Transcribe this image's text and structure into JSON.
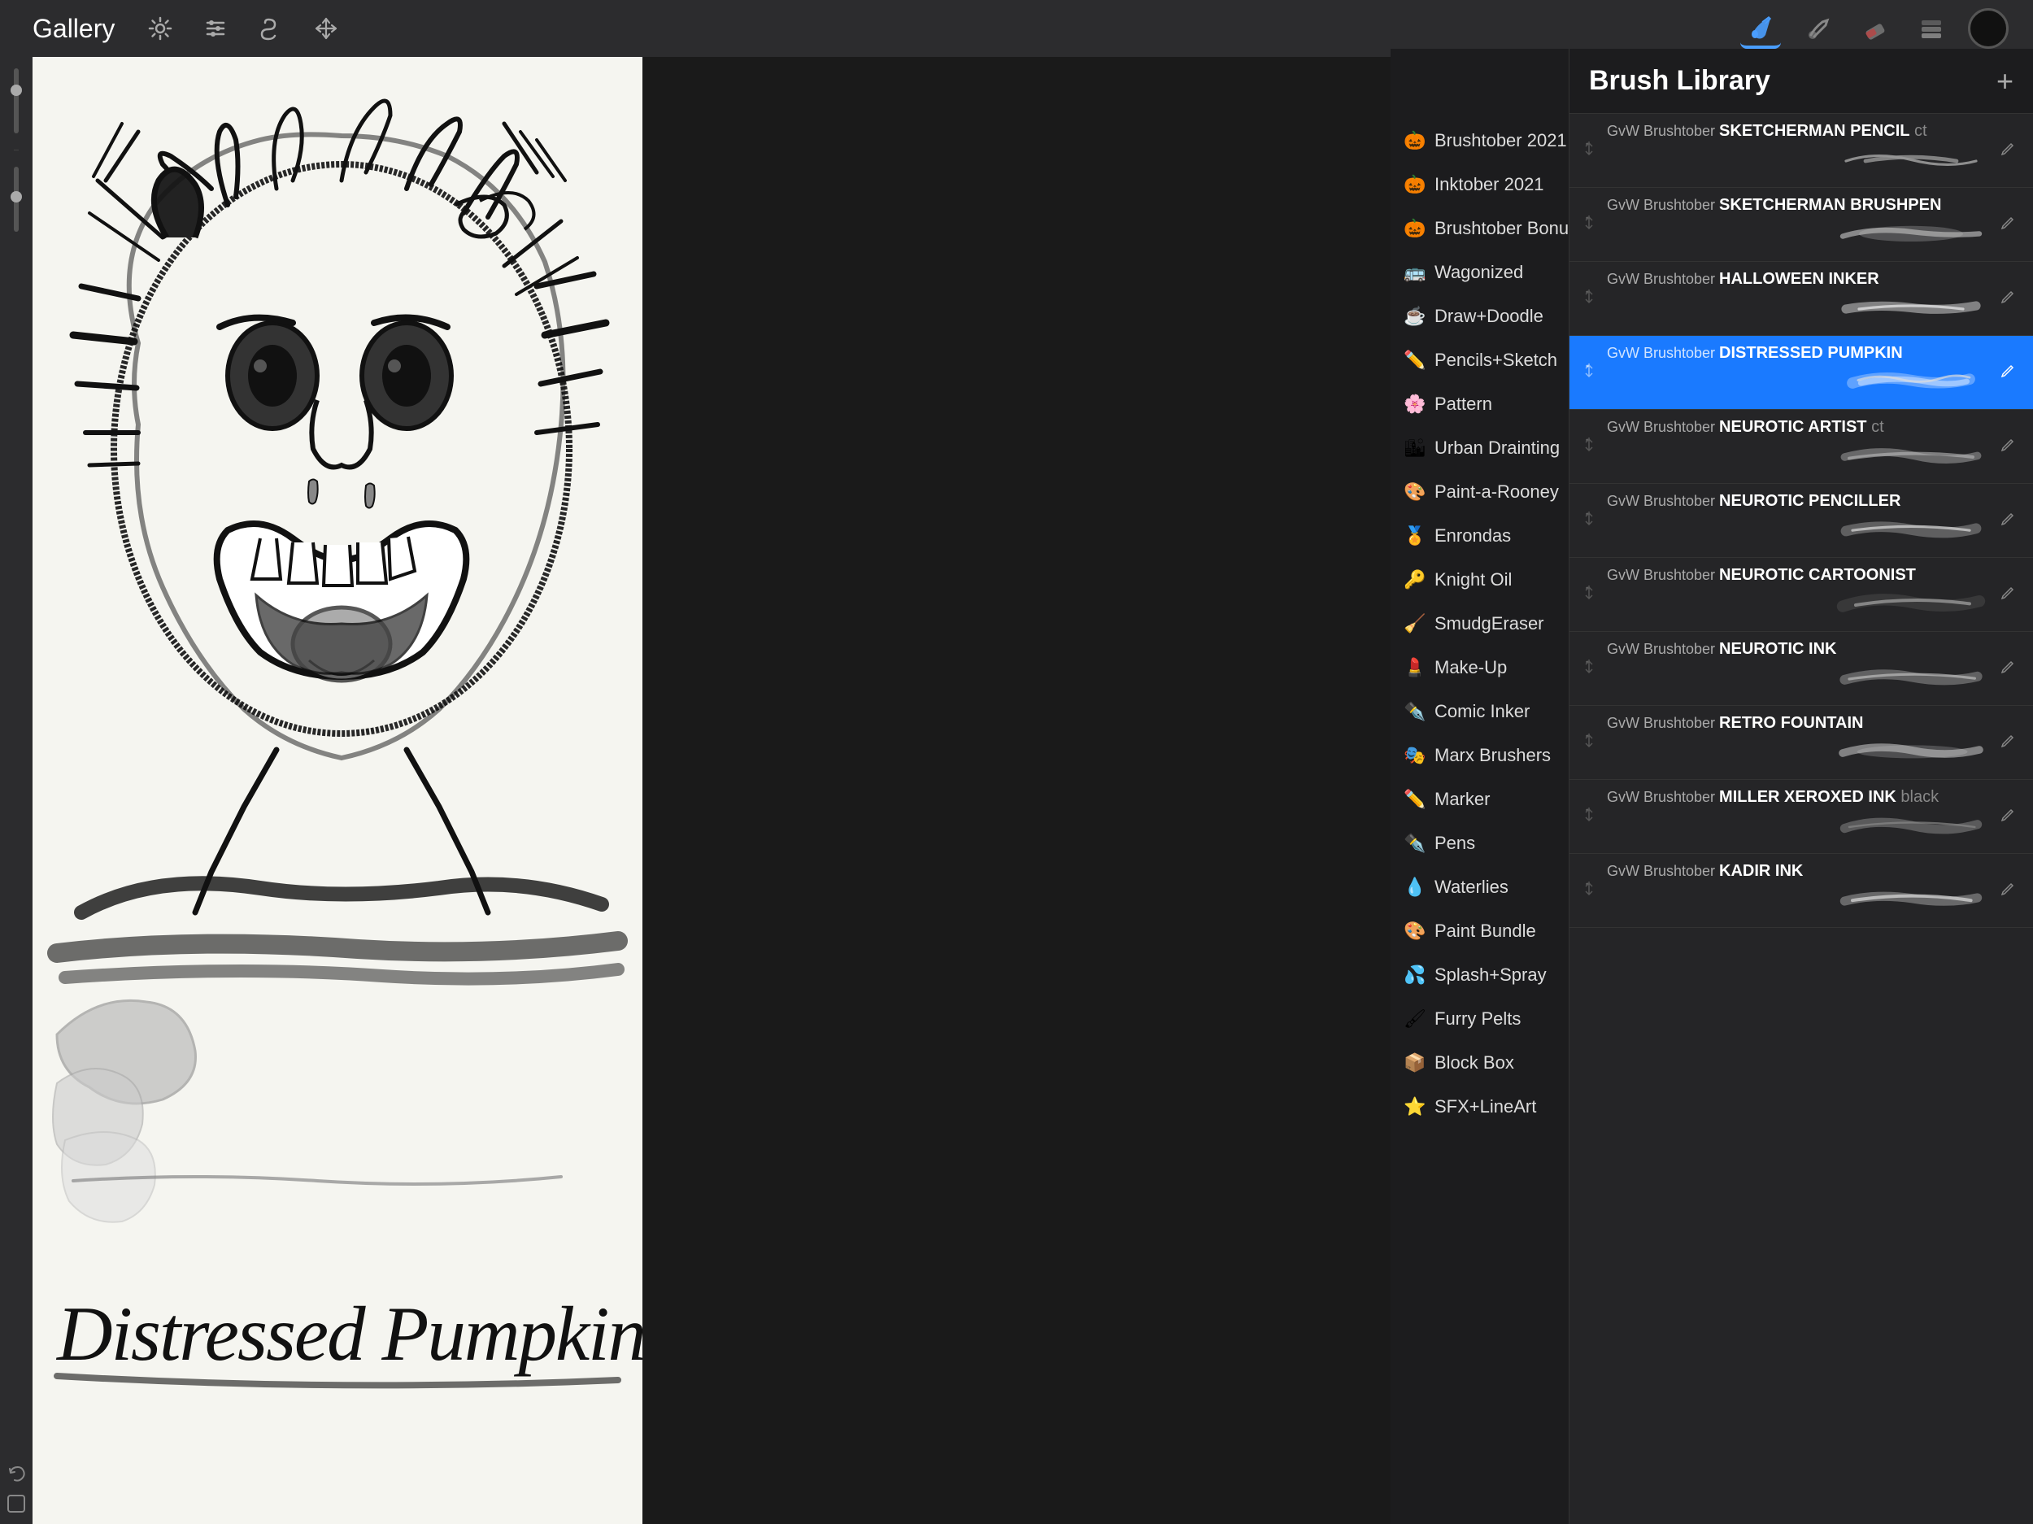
{
  "topBar": {
    "galleryLabel": "Gallery",
    "tools": [
      {
        "name": "settings",
        "icon": "⚙",
        "active": false
      },
      {
        "name": "adjust",
        "icon": "↺",
        "active": false
      },
      {
        "name": "smudge",
        "icon": "S",
        "active": false
      },
      {
        "name": "move",
        "icon": "↗",
        "active": false
      }
    ],
    "rightTools": [
      {
        "name": "brush",
        "icon": "brush",
        "active": true
      },
      {
        "name": "smudge-tool",
        "icon": "smudge",
        "active": false
      },
      {
        "name": "eraser",
        "icon": "eraser",
        "active": false
      },
      {
        "name": "layers",
        "icon": "layers",
        "active": false
      }
    ],
    "colorSwatch": "#111111"
  },
  "brushPanel": {
    "title": "Brush Library",
    "addButton": "+",
    "categories": [
      {
        "icon": "🎃",
        "label": "Brushtober 2021",
        "active": false
      },
      {
        "icon": "🎃",
        "label": "Inktober 2021",
        "active": false
      },
      {
        "icon": "🎃",
        "label": "Brushtober Bonus",
        "active": false
      },
      {
        "icon": "🚌",
        "label": "Wagonized",
        "active": false
      },
      {
        "icon": "☕",
        "label": "Draw+Doodle",
        "active": false
      },
      {
        "icon": "✏️",
        "label": "Pencils+Sketch",
        "active": false
      },
      {
        "icon": "🌸",
        "label": "Pattern",
        "active": false
      },
      {
        "icon": "🏙",
        "label": "Urban Drainting",
        "active": false
      },
      {
        "icon": "🎨",
        "label": "Paint-a-Rooney",
        "active": false
      },
      {
        "icon": "🏅",
        "label": "Enrondas",
        "active": false
      },
      {
        "icon": "🔑",
        "label": "Knight Oil",
        "active": false
      },
      {
        "icon": "🧹",
        "label": "SmudgEraser",
        "active": false
      },
      {
        "icon": "💄",
        "label": "Make-Up",
        "active": false
      },
      {
        "icon": "✒️",
        "label": "Comic Inker",
        "active": false
      },
      {
        "icon": "🎭",
        "label": "Marx Brushers",
        "active": false
      },
      {
        "icon": "✏️",
        "label": "Marker",
        "active": false
      },
      {
        "icon": "✒️",
        "label": "Pens",
        "active": false
      },
      {
        "icon": "💧",
        "label": "Waterlies",
        "active": false
      },
      {
        "icon": "🎨",
        "label": "Paint Bundle",
        "active": false
      },
      {
        "icon": "💦",
        "label": "Splash+Spray",
        "active": false
      },
      {
        "icon": "🖌",
        "label": "Furry Pelts",
        "active": false
      },
      {
        "icon": "📦",
        "label": "Block Box",
        "active": false
      },
      {
        "icon": "⭐",
        "label": "SFX+LineArt",
        "active": false
      }
    ],
    "brushes": [
      {
        "prefix": "GvW Brushtober",
        "name": "SKETCHERMAN PENCIL",
        "suffix": "ct",
        "selected": false,
        "hasEdit": true
      },
      {
        "prefix": "GvW Brushtober",
        "name": "SKETCHERMAN BRUSHPEN",
        "suffix": "",
        "selected": false,
        "hasEdit": true
      },
      {
        "prefix": "GvW Brushtober",
        "name": "HALLOWEEN INKER",
        "suffix": "",
        "selected": false,
        "hasEdit": true
      },
      {
        "prefix": "GvW Brushtober",
        "name": "DISTRESSED PUMPKIN",
        "suffix": "",
        "selected": true,
        "hasEdit": true
      },
      {
        "prefix": "GvW Brushtober",
        "name": "NEUROTIC ARTIST",
        "suffix": "ct",
        "selected": false,
        "hasEdit": true
      },
      {
        "prefix": "GvW Brushtober",
        "name": "NEUROTIC PENCILLER",
        "suffix": "",
        "selected": false,
        "hasEdit": true
      },
      {
        "prefix": "GvW Brushtober",
        "name": "NEUROTIC CARTOONIST",
        "suffix": "",
        "selected": false,
        "hasEdit": true
      },
      {
        "prefix": "GvW Brushtober",
        "name": "NEUROTIC INK",
        "suffix": "",
        "selected": false,
        "hasEdit": true
      },
      {
        "prefix": "GvW Brushtober",
        "name": "RETRO FOUNTAIN",
        "suffix": "",
        "selected": false,
        "hasEdit": true
      },
      {
        "prefix": "GvW Brushtober",
        "name": "MILLER XEROXED INK",
        "suffix": "black",
        "selected": false,
        "hasEdit": true
      },
      {
        "prefix": "GvW Brushtober",
        "name": "KADIR INK",
        "suffix": "",
        "selected": false,
        "hasEdit": true
      }
    ]
  },
  "canvas": {
    "title": "Distressed Pumpkin Brush"
  }
}
